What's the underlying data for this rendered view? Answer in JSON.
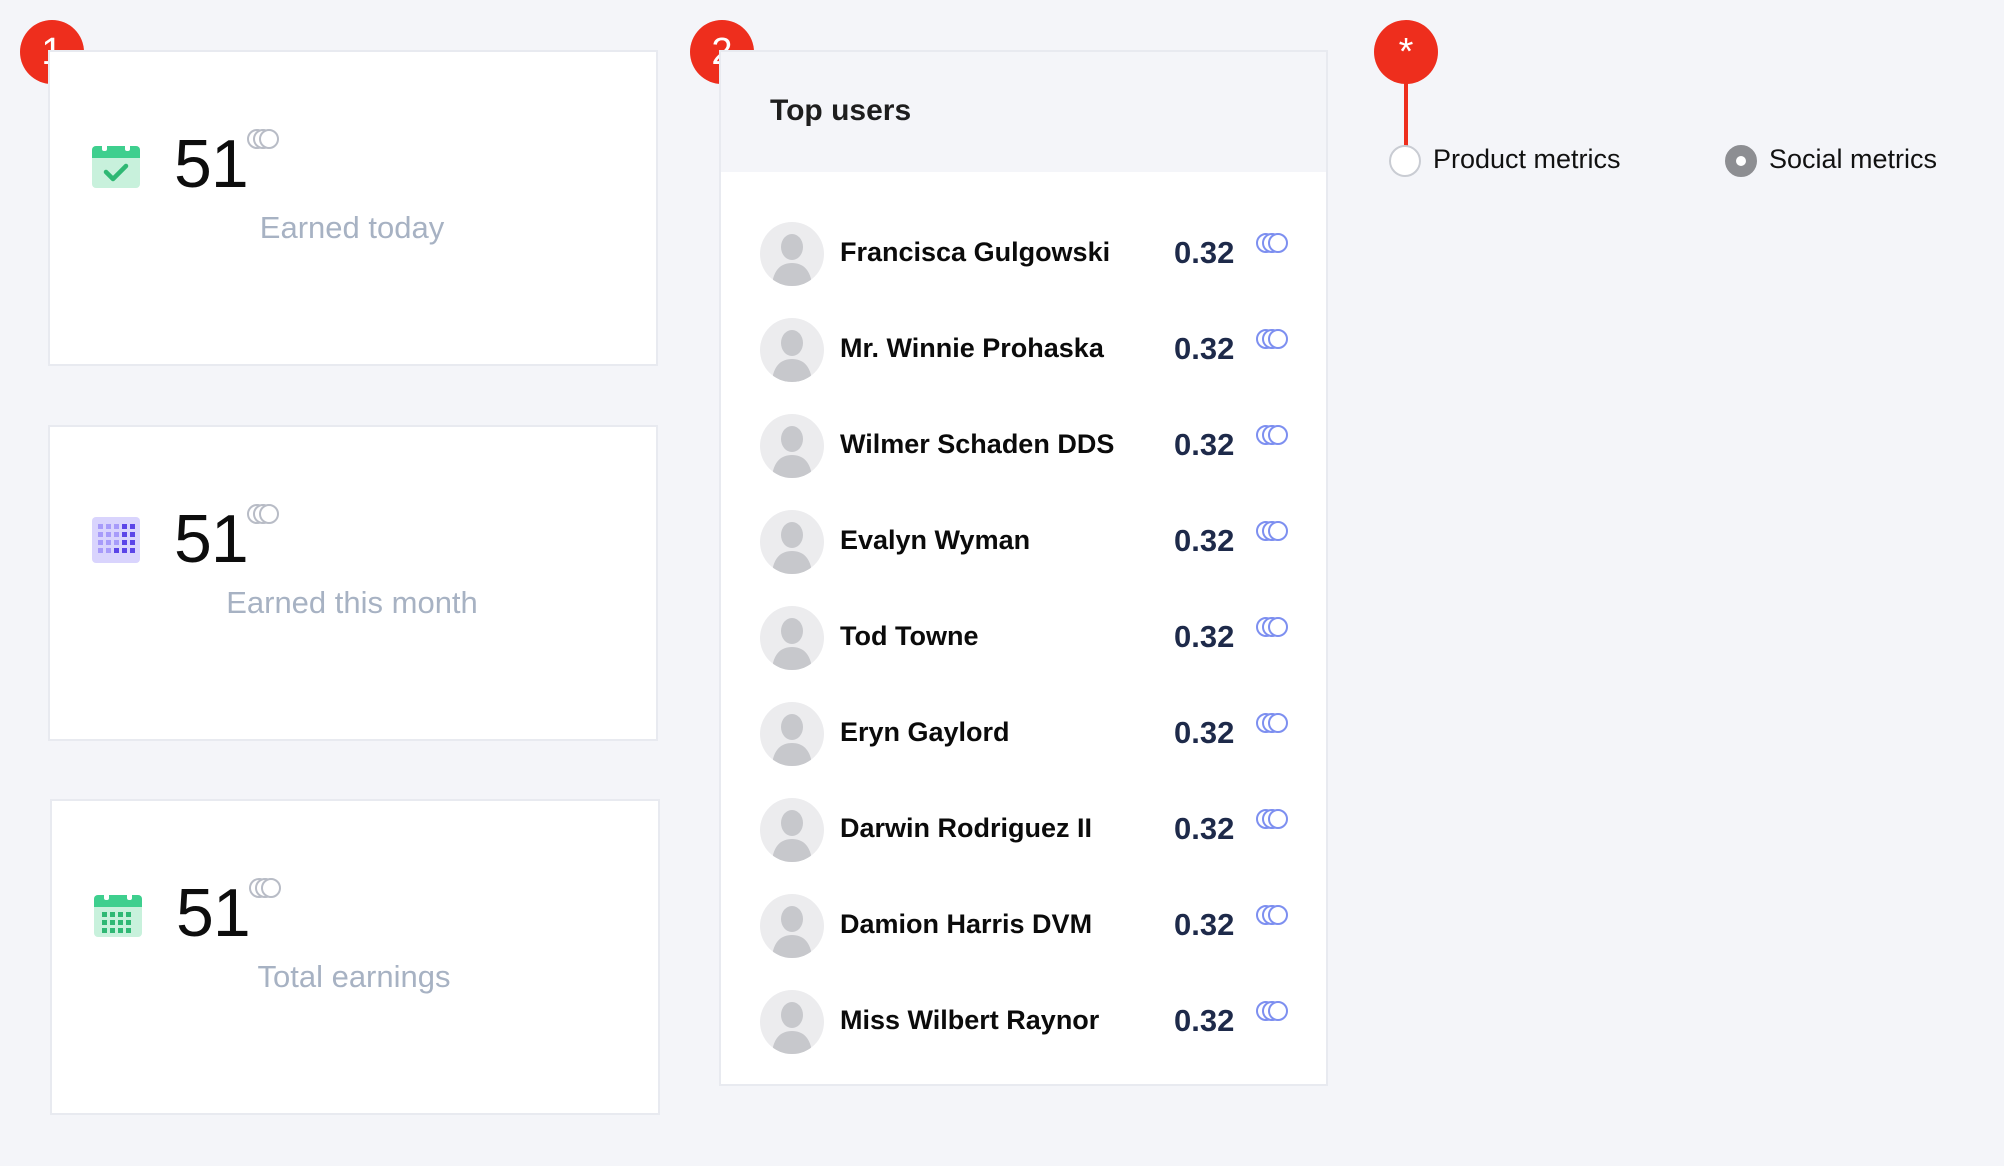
{
  "markers": {
    "earnings": "1",
    "top_users": "2",
    "metrics": "*"
  },
  "cards": [
    {
      "value": "51",
      "label": "Earned today",
      "icon": "calendar-check-icon",
      "icon_color": "#3ecf8e"
    },
    {
      "value": "51",
      "label": "Earned this month",
      "icon": "calendar-month-grid-icon",
      "icon_color": "#7b6cf6"
    },
    {
      "value": "51",
      "label": "Total earnings",
      "icon": "calendar-grid-icon",
      "icon_color": "#3ecf8e"
    }
  ],
  "top_users": {
    "title": "Top users",
    "users": [
      {
        "name": "Francisca Gulgowski",
        "score": "0.32"
      },
      {
        "name": "Mr. Winnie Prohaska",
        "score": "0.32"
      },
      {
        "name": "Wilmer Schaden DDS",
        "score": "0.32"
      },
      {
        "name": "Evalyn Wyman",
        "score": "0.32"
      },
      {
        "name": "Tod Towne",
        "score": "0.32"
      },
      {
        "name": "Eryn Gaylord",
        "score": "0.32"
      },
      {
        "name": "Darwin Rodriguez II",
        "score": "0.32"
      },
      {
        "name": "Damion Harris DVM",
        "score": "0.32"
      },
      {
        "name": "Miss Wilbert Raynor",
        "score": "0.32"
      }
    ]
  },
  "metrics_toggle": {
    "options": [
      {
        "label": "Product metrics",
        "checked": false
      },
      {
        "label": "Social metrics",
        "checked": true
      }
    ]
  },
  "colors": {
    "accent_marker": "#ee2e1d",
    "background": "#f4f5f9",
    "label_muted": "#a7b2c3",
    "score": "#1e2a4a",
    "coin_gray": "#b8bcc6",
    "coin_blue": "#7d8ff0"
  }
}
